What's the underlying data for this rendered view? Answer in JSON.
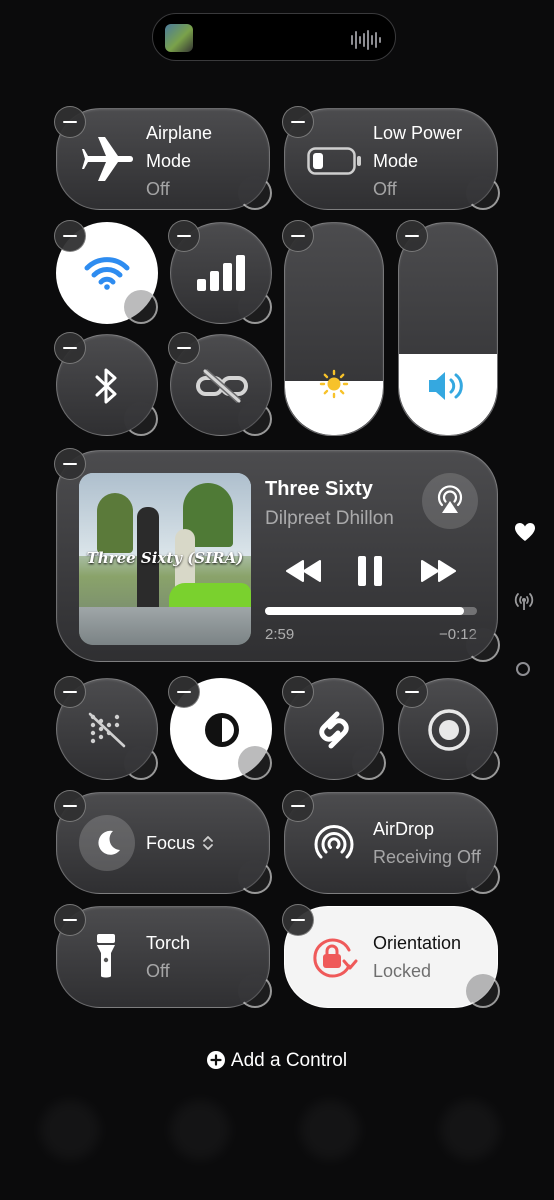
{
  "dynamic_island": {
    "activity": "now-playing",
    "thumbnail_icon": "album-art-icon",
    "waveform_icon": "waveform-icon"
  },
  "controls": {
    "airplane": {
      "title_line1": "Airplane",
      "title_line2": "Mode",
      "status": "Off"
    },
    "low_power": {
      "title_line1": "Low Power",
      "title_line2": "Mode",
      "status": "Off"
    },
    "wifi": {
      "state": "on"
    },
    "cellular": {
      "state": "on"
    },
    "bluetooth": {
      "state": "off"
    },
    "personal_hotspot": {
      "state": "off"
    },
    "brightness": {
      "level": 0.25
    },
    "volume": {
      "level": 0.38
    },
    "screen_mirroring": {
      "state": "off"
    },
    "dark_mode": {
      "state": "on"
    },
    "shazam": {
      "state": "off"
    },
    "screen_record": {
      "state": "off"
    },
    "focus": {
      "label": "Focus"
    },
    "airdrop": {
      "title": "AirDrop",
      "status": "Receiving Off"
    },
    "torch": {
      "title": "Torch",
      "status": "Off"
    },
    "orientation": {
      "title": "Orientation",
      "status": "Locked"
    }
  },
  "now_playing": {
    "title": "Three Sixty",
    "artist": "Dilpreet Dhillon",
    "elapsed": "2:59",
    "remaining": "−0:12",
    "progress": 0.94,
    "art_title": "Three Sixty (SIRA)"
  },
  "side_indicators": [
    "heart-icon",
    "antenna-icon",
    "page-dot-icon"
  ],
  "add_control": {
    "label": "Add a Control"
  },
  "colors": {
    "wifi_blue": "#2e8cf0",
    "brightness_yellow": "#f7c22a",
    "volume_blue": "#35a8e0",
    "orientation_red": "#ef5a5a"
  }
}
